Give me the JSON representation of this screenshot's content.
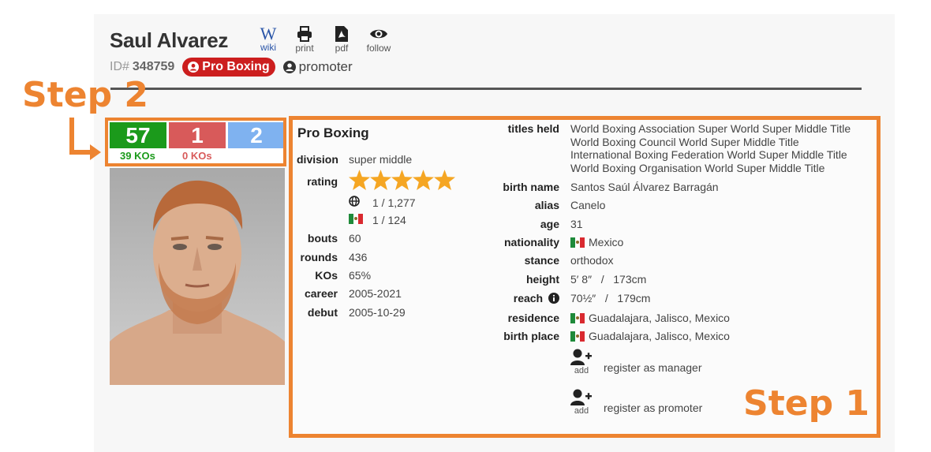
{
  "annotations": {
    "step1": "Step 1",
    "step2": "Step 2"
  },
  "colors": {
    "accent_orange": "#ed8431",
    "win_green": "#1b9a1b",
    "loss_red": "#d85a5a",
    "draw_blue": "#7fb2f0",
    "badge_red": "#cc1e1e"
  },
  "header": {
    "name": "Saul Alvarez",
    "actions": [
      {
        "icon": "wikipedia-icon",
        "label": "wiki"
      },
      {
        "icon": "print-icon",
        "label": "print"
      },
      {
        "icon": "pdf-icon",
        "label": "pdf"
      },
      {
        "icon": "eye-icon",
        "label": "follow"
      }
    ],
    "id_label": "ID#",
    "id_value": "348759",
    "badge_label": "Pro Boxing",
    "role_label": "promoter"
  },
  "record": {
    "wins": "57",
    "losses": "1",
    "draws": "2",
    "wins_kos": "39 KOs",
    "losses_kos": "0 KOs"
  },
  "profile": {
    "section_title": "Pro Boxing",
    "division_label": "division",
    "division": "super middle",
    "rating_label": "rating",
    "rating_stars": 5,
    "rank_world": "1 / 1,277",
    "rank_country": "1 / 124",
    "bouts_label": "bouts",
    "bouts": "60",
    "rounds_label": "rounds",
    "rounds": "436",
    "kos_label": "KOs",
    "kos": "65%",
    "career_label": "career",
    "career": "2005-2021",
    "debut_label": "debut",
    "debut": "2005-10-29"
  },
  "details": {
    "titles_label": "titles held",
    "titles": [
      "World Boxing Association Super World Super Middle Title",
      "World Boxing Council World Super Middle Title",
      "International Boxing Federation World Super Middle Title",
      "World Boxing Organisation World Super Middle Title"
    ],
    "birth_name_label": "birth name",
    "birth_name": "Santos Saúl Álvarez Barragán",
    "alias_label": "alias",
    "alias": "Canelo",
    "age_label": "age",
    "age": "31",
    "nationality_label": "nationality",
    "nationality": "Mexico",
    "stance_label": "stance",
    "stance": "orthodox",
    "height_label": "height",
    "height": "5′ 8″   /   173cm",
    "reach_label": "reach",
    "reach": "70½″   /   179cm",
    "residence_label": "residence",
    "residence": "Guadalajara, Jalisco, Mexico",
    "birth_place_label": "birth place",
    "birth_place": "Guadalajara, Jalisco, Mexico",
    "add_label": "add",
    "register_manager": "register as manager",
    "register_promoter": "register as promoter"
  }
}
